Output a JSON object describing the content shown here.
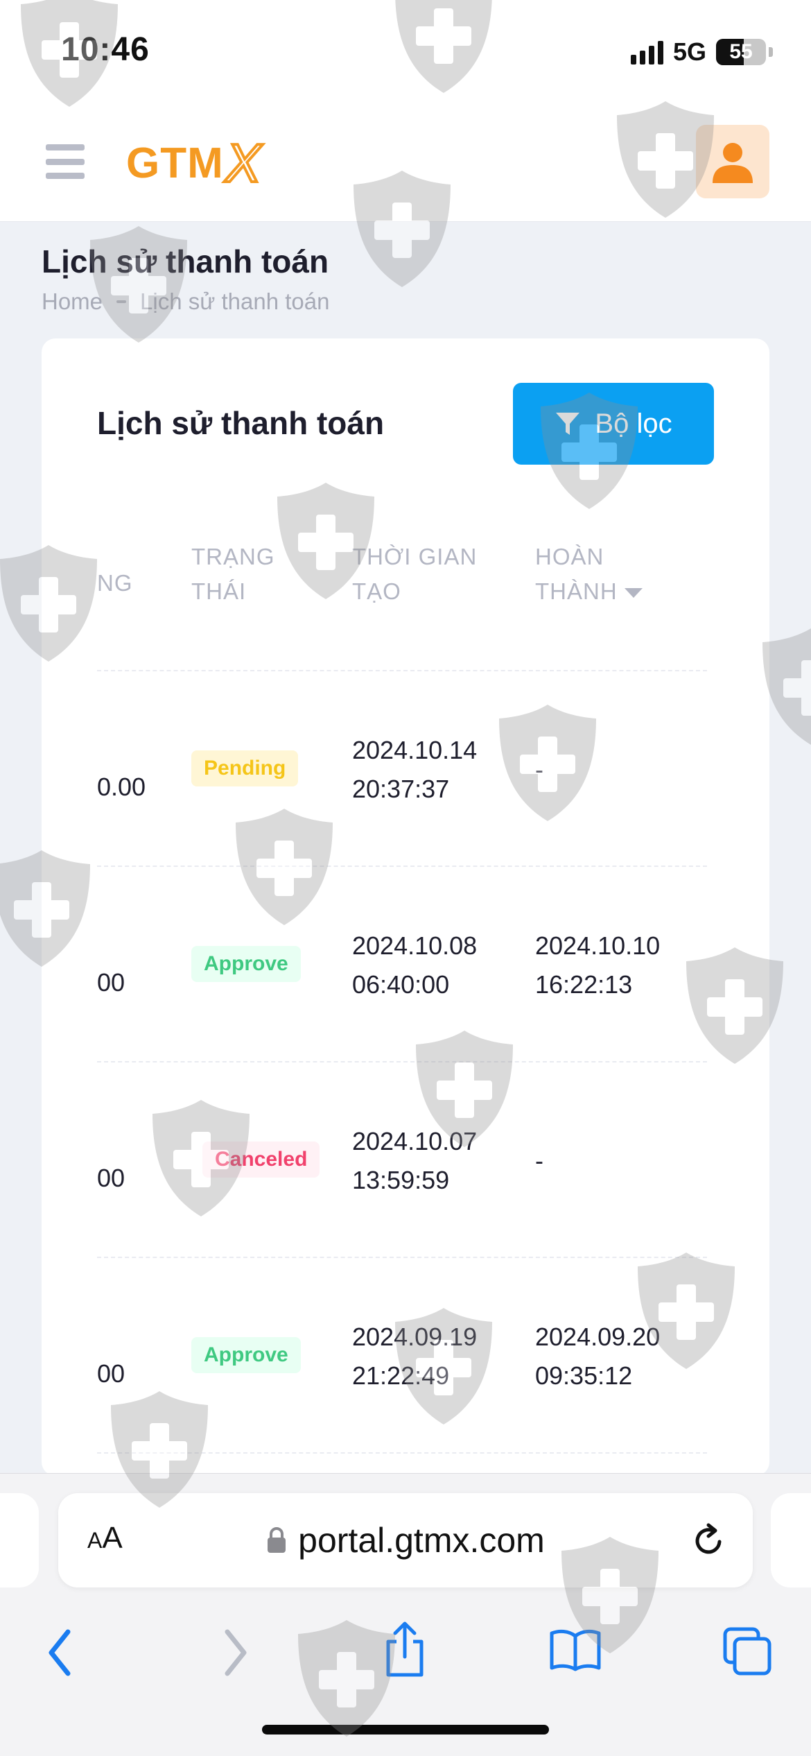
{
  "status_bar": {
    "time": "10:46",
    "network": "5G",
    "battery": "55"
  },
  "header": {
    "logo_text": "GTM",
    "logo_x": "X",
    "accent_color": "#f49a22"
  },
  "page": {
    "title": "Lịch sử thanh toán",
    "breadcrumb": {
      "home": "Home",
      "current": "Lịch sử thanh toán"
    }
  },
  "card": {
    "title": "Lịch sử thanh toán",
    "filter_label": "Bộ lọc",
    "filter_color": "#0ba0f2"
  },
  "table": {
    "columns": {
      "amount": "NG",
      "status": "TRẠNG\nTHÁI",
      "created": "THỜI GIAN\nTẠO",
      "completed": "HOÀN\nTHÀNH"
    },
    "rows": [
      {
        "amount": "0.00",
        "status": "Pending",
        "created": "2024.10.14\n20:37:37",
        "completed": "-"
      },
      {
        "amount": "00",
        "status": "Approve",
        "created": "2024.10.08\n06:40:00",
        "completed": "2024.10.10\n16:22:13"
      },
      {
        "amount": "00",
        "status": "Canceled",
        "created": "2024.10.07\n13:59:59",
        "completed": "-"
      },
      {
        "amount": "00",
        "status": "Approve",
        "created": "2024.09.19\n21:22:49",
        "completed": "2024.09.20\n09:35:12"
      }
    ]
  },
  "browser": {
    "aa_small": "A",
    "aa_large": "A",
    "url": "portal.gtmx.com",
    "icons": {
      "back": "chevron-left-icon",
      "forward": "chevron-right-icon",
      "share": "share-icon",
      "bookmarks": "book-icon",
      "tabs": "tabs-icon"
    },
    "toolbar_color": "#1a7cf0"
  }
}
